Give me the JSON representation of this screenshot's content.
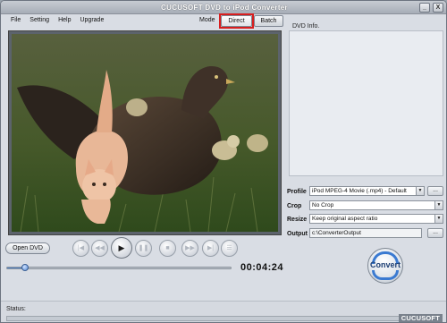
{
  "window": {
    "title": "CUCUSOFT DVD to  iPod  Converter",
    "minimize_glyph": "_",
    "close_glyph": "X"
  },
  "menu": {
    "items": [
      {
        "label": "File"
      },
      {
        "label": "Setting"
      },
      {
        "label": "Help"
      },
      {
        "label": "Upgrade"
      }
    ]
  },
  "mode": {
    "label": "Mode",
    "direct_label": "Direct",
    "batch_label": "Batch",
    "selected": "Direct",
    "highlight_color": "#d81e1e"
  },
  "dvd_info": {
    "label": "DVD Info."
  },
  "settings": {
    "profile": {
      "label": "Profile",
      "value": "iPod  MPEG-4 Movie (.mp4) - Default",
      "button": "..."
    },
    "crop": {
      "label": "Crop",
      "value": "No Crop"
    },
    "resize": {
      "label": "Resize",
      "value": "Keep original aspect ratio"
    },
    "output": {
      "label": "Output",
      "value": "c:\\ConverterOutput",
      "button": "..."
    }
  },
  "controls": {
    "open_dvd_label": "Open DVD",
    "buttons": [
      {
        "name": "skip-start",
        "glyph": "|◀",
        "enabled": false
      },
      {
        "name": "rewind",
        "glyph": "◀◀",
        "enabled": false
      },
      {
        "name": "play",
        "glyph": "▶",
        "enabled": true
      },
      {
        "name": "pause",
        "glyph": "❚❚",
        "enabled": false
      },
      {
        "name": "stop",
        "glyph": "■",
        "enabled": false
      },
      {
        "name": "fast-forward",
        "glyph": "▶▶",
        "enabled": false
      },
      {
        "name": "skip-end",
        "glyph": "▶|",
        "enabled": false
      },
      {
        "name": "chapter-list",
        "glyph": "☰",
        "enabled": false
      }
    ],
    "time": "00:04:24",
    "progress_fraction": 0.08,
    "accent_color": "#4f80c4"
  },
  "convert": {
    "label": "Convert"
  },
  "status": {
    "label": "Status:",
    "progress_fraction": 0.0,
    "brand": "CUCUSOFT"
  }
}
